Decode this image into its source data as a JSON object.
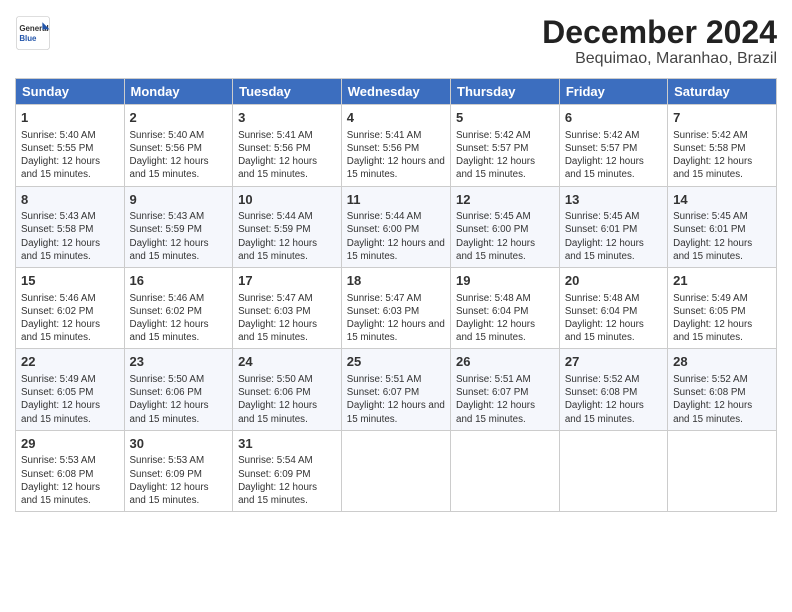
{
  "logo": {
    "line1": "General",
    "line2": "Blue"
  },
  "title": "December 2024",
  "location": "Bequimao, Maranhao, Brazil",
  "days_of_week": [
    "Sunday",
    "Monday",
    "Tuesday",
    "Wednesday",
    "Thursday",
    "Friday",
    "Saturday"
  ],
  "weeks": [
    [
      {
        "day": "1",
        "sunrise": "5:40 AM",
        "sunset": "5:55 PM",
        "daylight": "12 hours and 15 minutes."
      },
      {
        "day": "2",
        "sunrise": "5:40 AM",
        "sunset": "5:56 PM",
        "daylight": "12 hours and 15 minutes."
      },
      {
        "day": "3",
        "sunrise": "5:41 AM",
        "sunset": "5:56 PM",
        "daylight": "12 hours and 15 minutes."
      },
      {
        "day": "4",
        "sunrise": "5:41 AM",
        "sunset": "5:56 PM",
        "daylight": "12 hours and 15 minutes."
      },
      {
        "day": "5",
        "sunrise": "5:42 AM",
        "sunset": "5:57 PM",
        "daylight": "12 hours and 15 minutes."
      },
      {
        "day": "6",
        "sunrise": "5:42 AM",
        "sunset": "5:57 PM",
        "daylight": "12 hours and 15 minutes."
      },
      {
        "day": "7",
        "sunrise": "5:42 AM",
        "sunset": "5:58 PM",
        "daylight": "12 hours and 15 minutes."
      }
    ],
    [
      {
        "day": "8",
        "sunrise": "5:43 AM",
        "sunset": "5:58 PM",
        "daylight": "12 hours and 15 minutes."
      },
      {
        "day": "9",
        "sunrise": "5:43 AM",
        "sunset": "5:59 PM",
        "daylight": "12 hours and 15 minutes."
      },
      {
        "day": "10",
        "sunrise": "5:44 AM",
        "sunset": "5:59 PM",
        "daylight": "12 hours and 15 minutes."
      },
      {
        "day": "11",
        "sunrise": "5:44 AM",
        "sunset": "6:00 PM",
        "daylight": "12 hours and 15 minutes."
      },
      {
        "day": "12",
        "sunrise": "5:45 AM",
        "sunset": "6:00 PM",
        "daylight": "12 hours and 15 minutes."
      },
      {
        "day": "13",
        "sunrise": "5:45 AM",
        "sunset": "6:01 PM",
        "daylight": "12 hours and 15 minutes."
      },
      {
        "day": "14",
        "sunrise": "5:45 AM",
        "sunset": "6:01 PM",
        "daylight": "12 hours and 15 minutes."
      }
    ],
    [
      {
        "day": "15",
        "sunrise": "5:46 AM",
        "sunset": "6:02 PM",
        "daylight": "12 hours and 15 minutes."
      },
      {
        "day": "16",
        "sunrise": "5:46 AM",
        "sunset": "6:02 PM",
        "daylight": "12 hours and 15 minutes."
      },
      {
        "day": "17",
        "sunrise": "5:47 AM",
        "sunset": "6:03 PM",
        "daylight": "12 hours and 15 minutes."
      },
      {
        "day": "18",
        "sunrise": "5:47 AM",
        "sunset": "6:03 PM",
        "daylight": "12 hours and 15 minutes."
      },
      {
        "day": "19",
        "sunrise": "5:48 AM",
        "sunset": "6:04 PM",
        "daylight": "12 hours and 15 minutes."
      },
      {
        "day": "20",
        "sunrise": "5:48 AM",
        "sunset": "6:04 PM",
        "daylight": "12 hours and 15 minutes."
      },
      {
        "day": "21",
        "sunrise": "5:49 AM",
        "sunset": "6:05 PM",
        "daylight": "12 hours and 15 minutes."
      }
    ],
    [
      {
        "day": "22",
        "sunrise": "5:49 AM",
        "sunset": "6:05 PM",
        "daylight": "12 hours and 15 minutes."
      },
      {
        "day": "23",
        "sunrise": "5:50 AM",
        "sunset": "6:06 PM",
        "daylight": "12 hours and 15 minutes."
      },
      {
        "day": "24",
        "sunrise": "5:50 AM",
        "sunset": "6:06 PM",
        "daylight": "12 hours and 15 minutes."
      },
      {
        "day": "25",
        "sunrise": "5:51 AM",
        "sunset": "6:07 PM",
        "daylight": "12 hours and 15 minutes."
      },
      {
        "day": "26",
        "sunrise": "5:51 AM",
        "sunset": "6:07 PM",
        "daylight": "12 hours and 15 minutes."
      },
      {
        "day": "27",
        "sunrise": "5:52 AM",
        "sunset": "6:08 PM",
        "daylight": "12 hours and 15 minutes."
      },
      {
        "day": "28",
        "sunrise": "5:52 AM",
        "sunset": "6:08 PM",
        "daylight": "12 hours and 15 minutes."
      }
    ],
    [
      {
        "day": "29",
        "sunrise": "5:53 AM",
        "sunset": "6:08 PM",
        "daylight": "12 hours and 15 minutes."
      },
      {
        "day": "30",
        "sunrise": "5:53 AM",
        "sunset": "6:09 PM",
        "daylight": "12 hours and 15 minutes."
      },
      {
        "day": "31",
        "sunrise": "5:54 AM",
        "sunset": "6:09 PM",
        "daylight": "12 hours and 15 minutes."
      },
      null,
      null,
      null,
      null
    ]
  ]
}
